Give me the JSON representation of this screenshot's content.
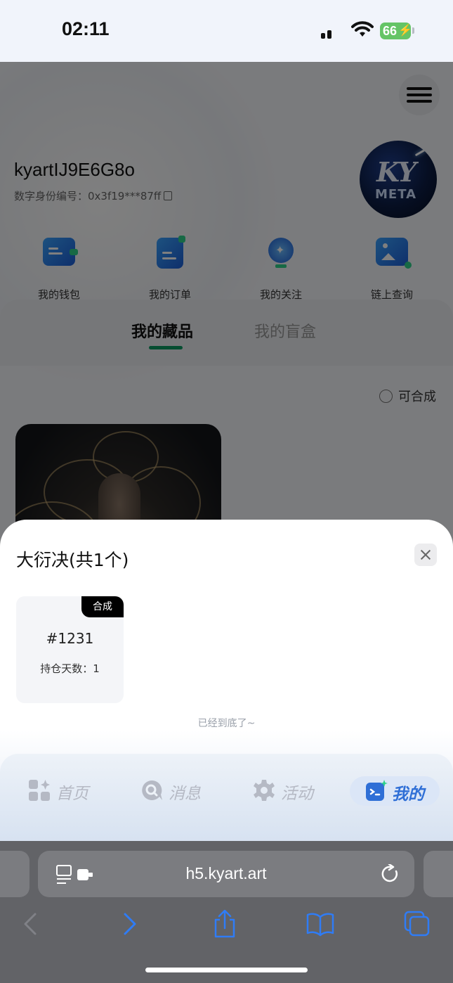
{
  "status_bar": {
    "time": "02:11",
    "battery": "66"
  },
  "profile": {
    "username": "kyartIJ9E6G8o",
    "did_label": "数字身份编号：",
    "did_value": "0x3f19***87ff",
    "avatar_text_top": "KY",
    "avatar_text_bottom": "META"
  },
  "quick_links": [
    {
      "label": "我的钱包",
      "icon": "wallet-icon"
    },
    {
      "label": "我的订单",
      "icon": "order-icon"
    },
    {
      "label": "我的关注",
      "icon": "bulb-icon"
    },
    {
      "label": "链上查询",
      "icon": "image-icon"
    }
  ],
  "tabs": {
    "active": "我的藏品",
    "inactive": "我的盲盒"
  },
  "filter": {
    "label": "可合成"
  },
  "sheet": {
    "title": "大衍决(共1个)",
    "item": {
      "badge": "合成",
      "number": "#1231",
      "days": "持仓天数：1"
    },
    "end_tip": "已经到底了~"
  },
  "app_nav": [
    {
      "label": "首页",
      "icon": "home-grid-icon",
      "active": false
    },
    {
      "label": "消息",
      "icon": "message-icon",
      "active": false
    },
    {
      "label": "活动",
      "icon": "gear-icon",
      "active": false
    },
    {
      "label": "我的",
      "icon": "profile-icon",
      "active": true
    }
  ],
  "browser": {
    "url": "h5.kyart.art"
  },
  "colors": {
    "accent_green": "#0c9a63",
    "nav_active": "#2f6fd6",
    "browser_blue": "#2f7cf6"
  }
}
